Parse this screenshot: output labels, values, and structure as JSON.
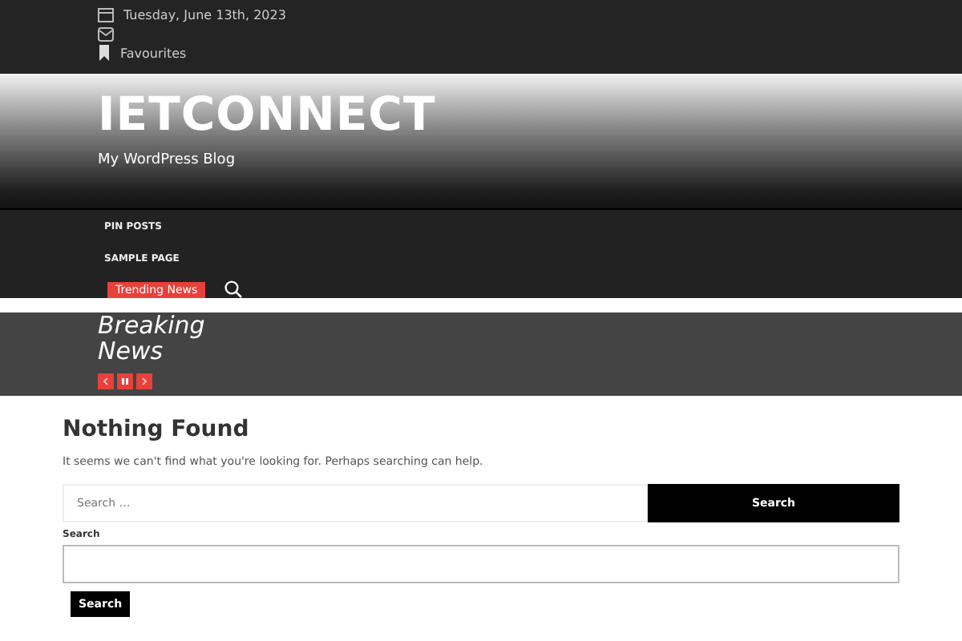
{
  "top_bar": {
    "date": "Tuesday, June 13th, 2023",
    "favourites": "Favourites"
  },
  "header": {
    "site_title": "IETCONNECT",
    "tagline": "My WordPress Blog"
  },
  "nav": {
    "items": [
      {
        "label": "PIN POSTS"
      },
      {
        "label": "SAMPLE PAGE"
      }
    ],
    "trending": "Trending News"
  },
  "breaking": {
    "title": "Breaking News"
  },
  "content": {
    "heading": "Nothing Found",
    "message": "It seems we can't find what you're looking for. Perhaps searching can help.",
    "search_form": {
      "placeholder": "Search …",
      "button": "Search"
    },
    "search_widget": {
      "label": "Search",
      "button": "Search"
    }
  }
}
